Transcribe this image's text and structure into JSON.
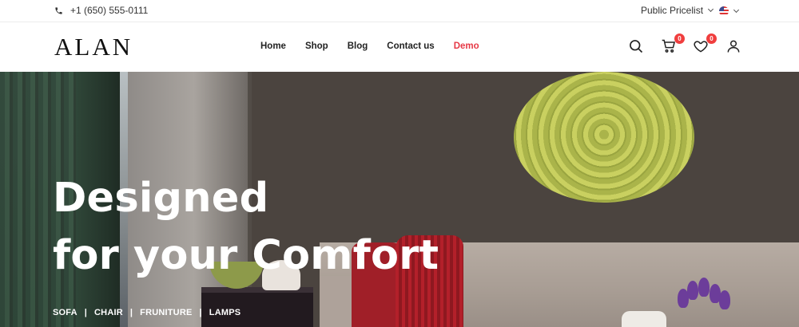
{
  "topbar": {
    "phone_icon": "phone-icon",
    "phone": "+1 (650) 555-0111",
    "pricelist": "Public Pricelist",
    "language_flag": "us-flag-icon"
  },
  "header": {
    "logo": "ALAN",
    "nav": [
      {
        "label": "Home"
      },
      {
        "label": "Shop"
      },
      {
        "label": "Blog"
      },
      {
        "label": "Contact us"
      },
      {
        "label": "Demo",
        "color": "#e63946"
      }
    ],
    "cart_count": "0",
    "wishlist_count": "0"
  },
  "hero": {
    "title_line1": "Designed",
    "title_line2": "for your Comfort",
    "tags": [
      "SOFA",
      "CHAIR",
      "FRUNITURE",
      "LAMPS"
    ],
    "separator": "|"
  },
  "colors": {
    "accent": "#e63946",
    "badge": "#f03e3e"
  }
}
